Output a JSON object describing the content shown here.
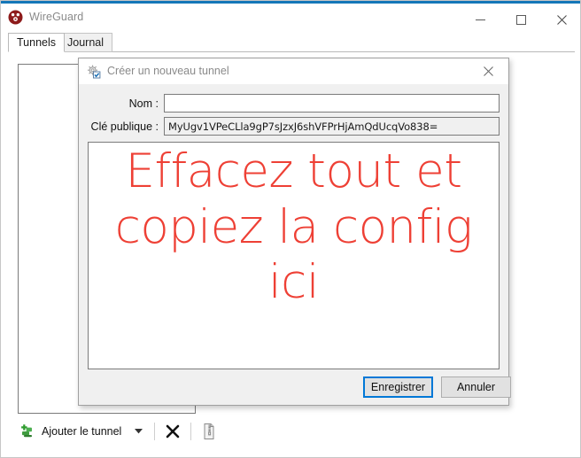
{
  "window": {
    "title": "WireGuard",
    "logo_icon": "wireguard-logo-icon",
    "accent_color": "#1477b8",
    "controls": {
      "minimize_icon": "minimize-icon",
      "maximize_icon": "maximize-icon",
      "close_icon": "close-icon"
    }
  },
  "tabs": [
    {
      "label": "Tunnels",
      "active": true
    },
    {
      "label": "Journal",
      "active": false
    }
  ],
  "tunnel_list": {
    "items": []
  },
  "toolbar": {
    "add_tunnel_label": "Ajouter le tunnel",
    "add_tunnel_icon": "add-tunnel-icon",
    "dropdown_icon": "chevron-down-icon",
    "delete_icon": "close-x-icon",
    "export_icon": "zip-archive-icon"
  },
  "dialog": {
    "title": "Créer un nouveau tunnel",
    "title_icon": "new-tunnel-icon",
    "close_icon": "close-icon",
    "fields": {
      "name_label": "Nom :",
      "name_value": "",
      "name_placeholder": "",
      "pubkey_label": "Clé publique :",
      "pubkey_value": "MyUgv1VPeCLla9gP7sJzxJ6shVFPrHjAmQdUcqVo838="
    },
    "config_text": "Effacez tout et copiez la config ici",
    "config_text_color": "#ee4035",
    "buttons": {
      "save_label": "Enregistrer",
      "cancel_label": "Annuler",
      "focus_color": "#0078d7"
    }
  }
}
